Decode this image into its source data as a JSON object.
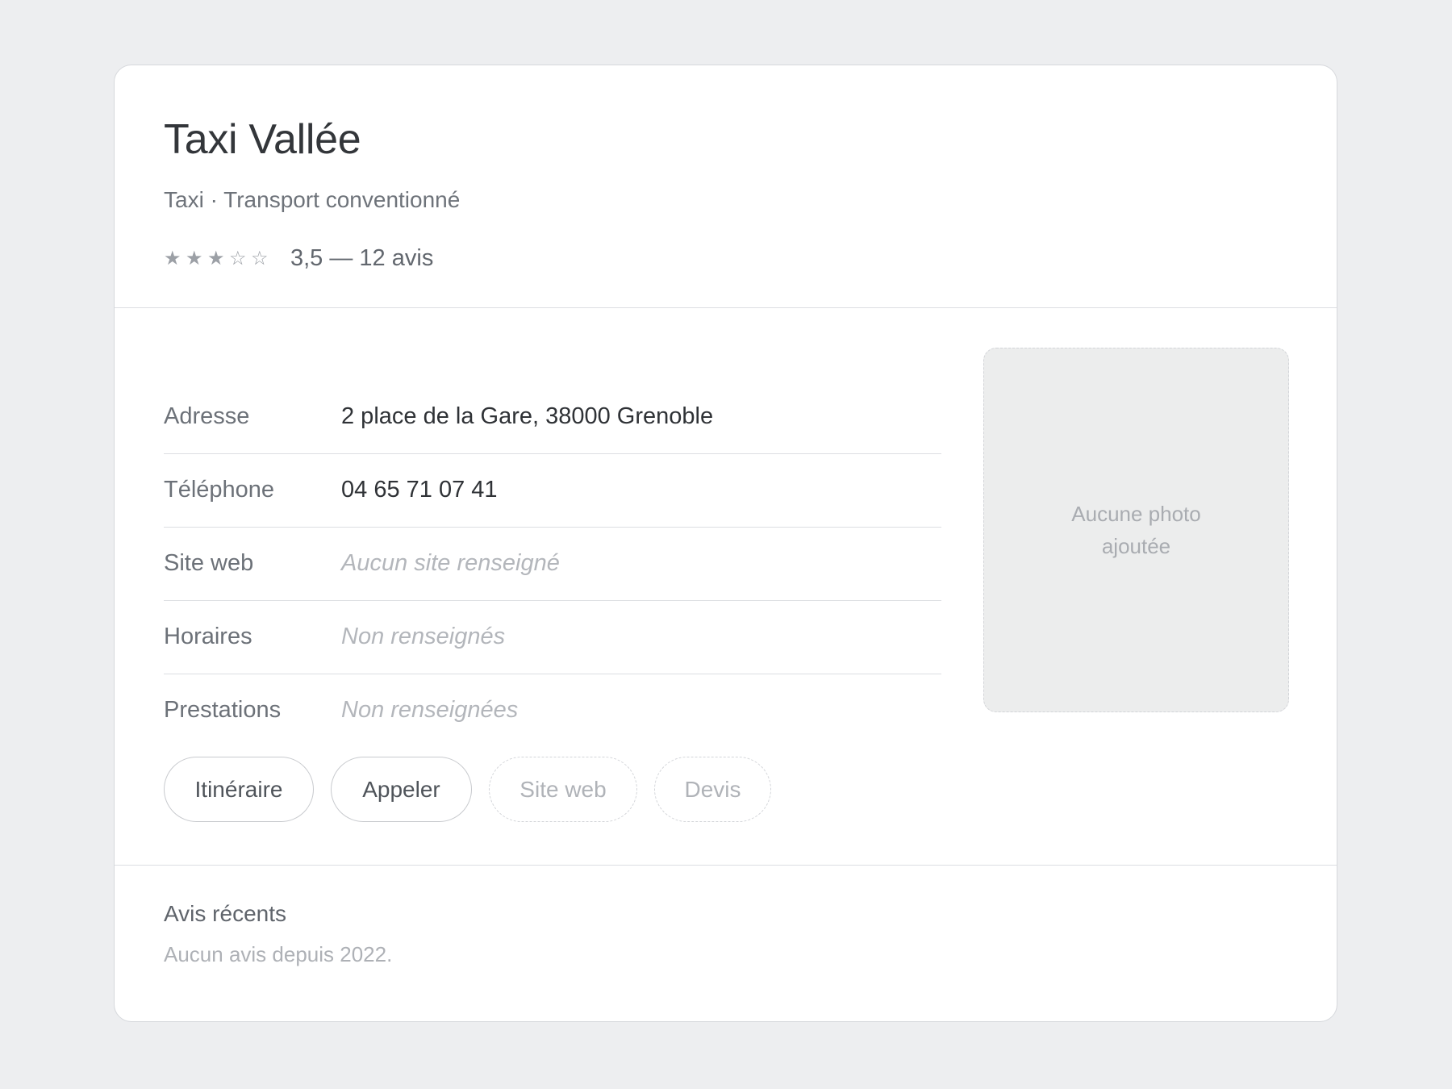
{
  "business": {
    "name": "Taxi Vallée",
    "category": "Taxi · Transport conventionné",
    "rating": {
      "stars": [
        "★",
        "★",
        "★",
        "☆",
        "☆"
      ],
      "filled_stars": 3,
      "text": "3,5 — 12 avis"
    }
  },
  "details": [
    {
      "label": "Adresse",
      "value": "2 place de la Gare, 38000 Grenoble",
      "empty": false
    },
    {
      "label": "Téléphone",
      "value": "04 65 71 07 41",
      "empty": false
    },
    {
      "label": "Site web",
      "value": "Aucun site renseigné",
      "empty": true
    },
    {
      "label": "Horaires",
      "value": "Non renseignés",
      "empty": true
    },
    {
      "label": "Prestations",
      "value": "Non renseignées",
      "empty": true
    }
  ],
  "photo": {
    "placeholder": "Aucune photo ajoutée"
  },
  "actions": {
    "itineraire": "Itinéraire",
    "appeler": "Appeler",
    "site_web": "Site web",
    "devis": "Devis"
  },
  "reviews": {
    "title": "Avis récents",
    "empty_text": "Aucun avis depuis 2022."
  }
}
